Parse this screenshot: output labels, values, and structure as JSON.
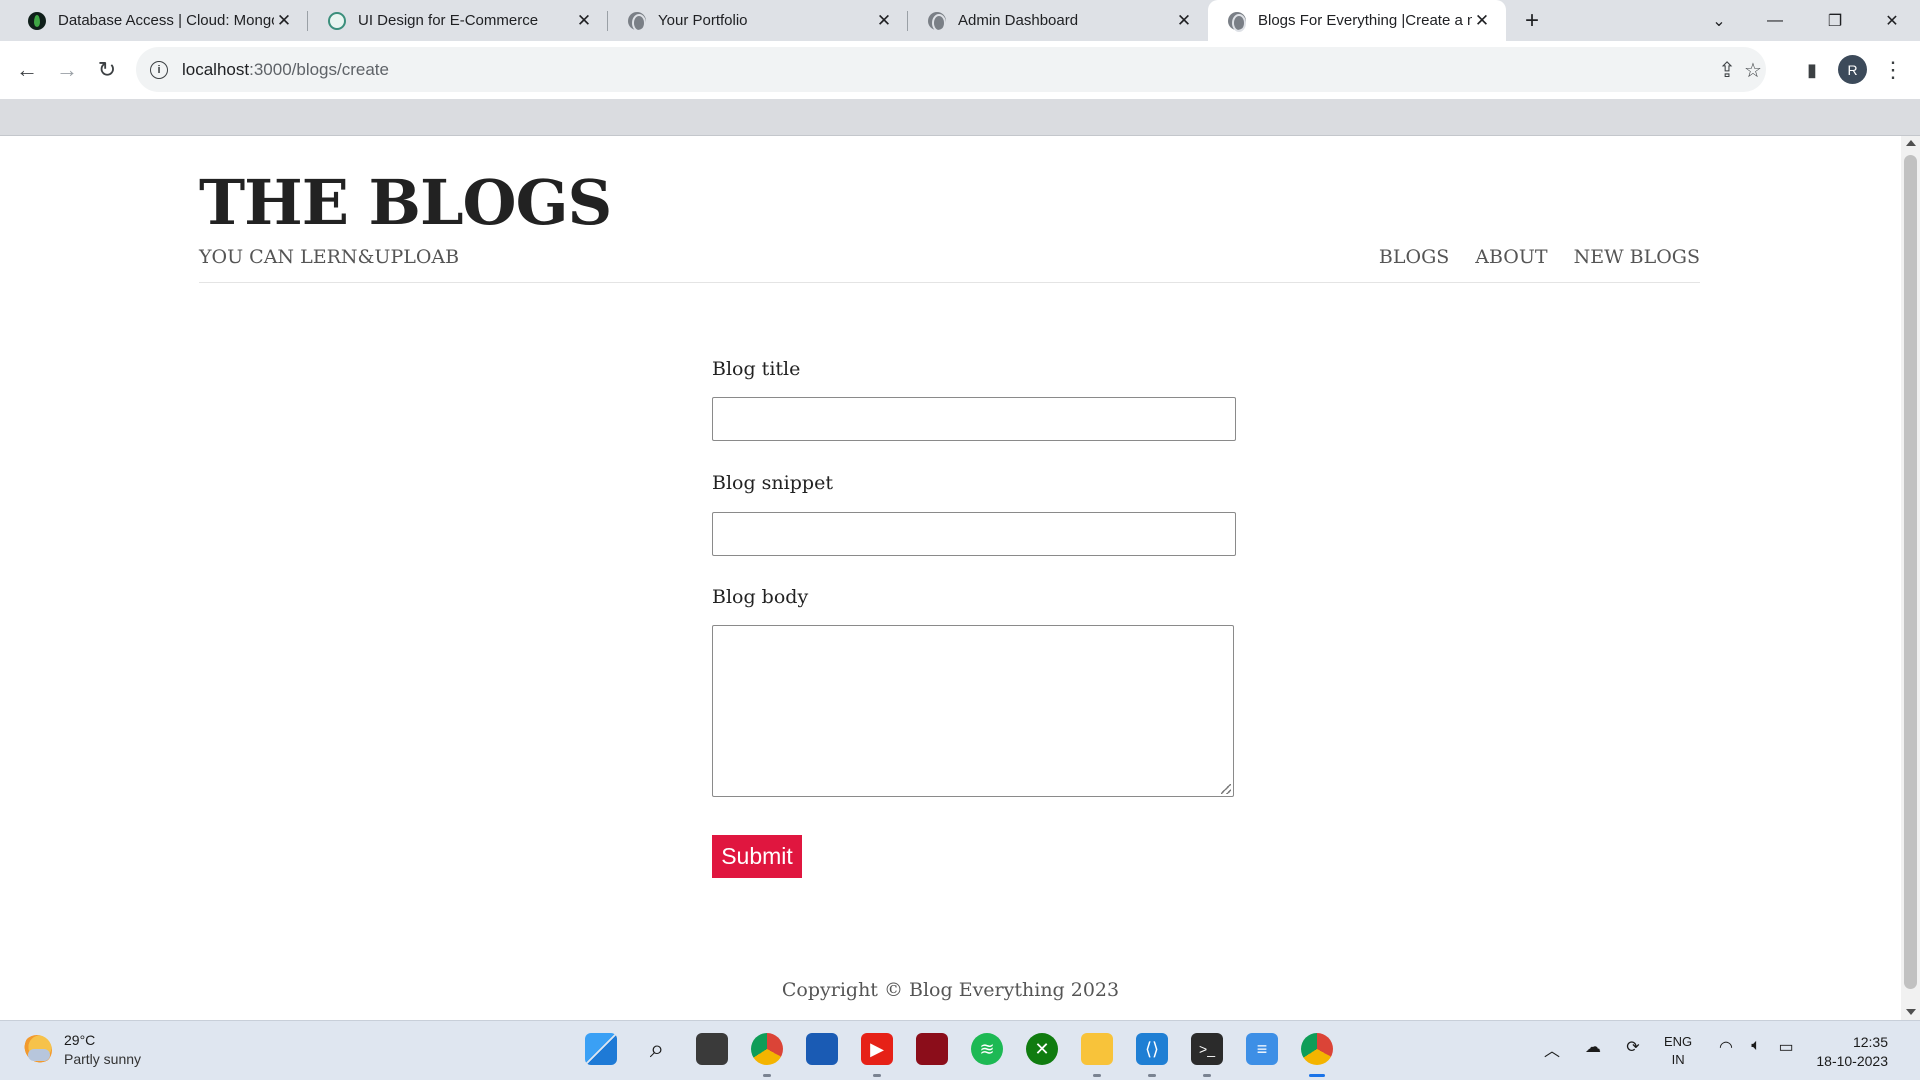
{
  "browser": {
    "tabs": [
      {
        "title": "Database Access | Cloud: MongoDB",
        "icon": "mongodb-leaf-icon",
        "active": false
      },
      {
        "title": "UI Design for E-Commerce",
        "icon": "chatgpt-icon",
        "active": false
      },
      {
        "title": "Your Portfolio",
        "icon": "globe-icon",
        "active": false
      },
      {
        "title": "Admin Dashboard",
        "icon": "globe-icon",
        "active": false
      },
      {
        "title": "Blogs For Everything |Create a new blog",
        "icon": "globe-icon",
        "active": true
      }
    ],
    "address": {
      "host": "localhost",
      "path": ":3000/blogs/create"
    },
    "profile_initial": "R"
  },
  "site": {
    "title": "THE BLOGS",
    "tagline": "YOU CAN LERN&UPLOAB",
    "nav": [
      {
        "label": "BLOGS"
      },
      {
        "label": "ABOUT"
      },
      {
        "label": "NEW BLOGS"
      }
    ]
  },
  "form": {
    "title_label": "Blog title",
    "title_value": "",
    "snippet_label": "Blog snippet",
    "snippet_value": "",
    "body_label": "Blog body",
    "body_value": "",
    "submit_label": "Submit"
  },
  "footer": {
    "copyright": "Copyright © Blog Everything 2023"
  },
  "taskbar": {
    "weather_temp": "29°C",
    "weather_desc": "Partly sunny",
    "lang_line1": "ENG",
    "lang_line2": "IN",
    "time": "12:35",
    "date": "18-10-2023"
  },
  "colors": {
    "submit_bg": "#e0163f",
    "title_text": "#222222",
    "muted_text": "#555555"
  }
}
